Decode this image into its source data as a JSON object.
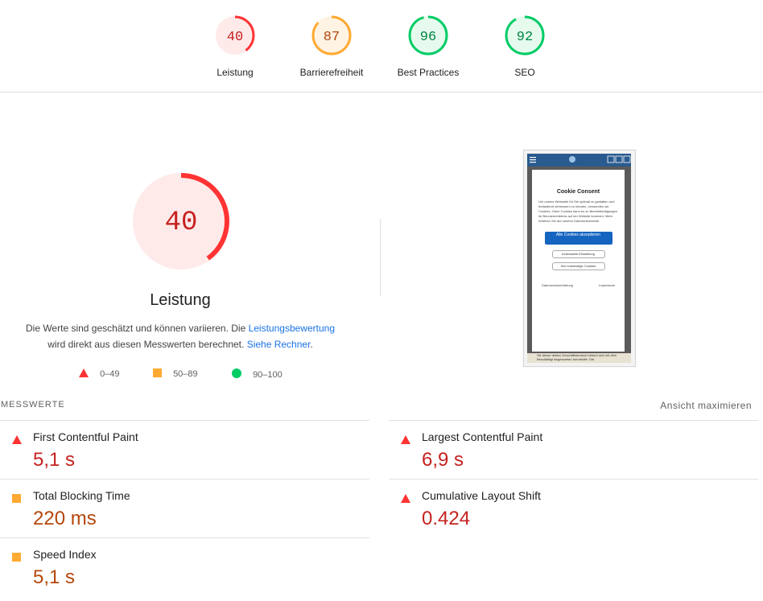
{
  "colors": {
    "fail": "#f33",
    "average": "#fa3",
    "pass": "#0c6",
    "fail_text": "#c5221f",
    "average_text": "#b5470b",
    "link": "#1a73e8"
  },
  "gauges": [
    {
      "score": "40",
      "label": "Leistung",
      "status": "fail"
    },
    {
      "score": "87",
      "label": "Barrierefreiheit",
      "status": "average"
    },
    {
      "score": "96",
      "label": "Best Practices",
      "status": "pass"
    },
    {
      "score": "92",
      "label": "SEO",
      "status": "pass"
    }
  ],
  "performance": {
    "score": "40",
    "title": "Leistung",
    "desc_part1": "Die Werte sind geschätzt und können variieren. Die ",
    "desc_link1": "Leistungsbewertung",
    "desc_part2": "wird direkt aus diesen Messwerten berechnet. ",
    "desc_link2": "Siehe Rechner",
    "desc_part3": "."
  },
  "legend": [
    {
      "icon": "triangle-icon",
      "range": "0–49"
    },
    {
      "icon": "square-icon",
      "range": "50–89"
    },
    {
      "icon": "circle-icon",
      "range": "90–100"
    }
  ],
  "screenshot": {
    "dialog_title": "Cookie Consent",
    "dialog_text": "Um unsere Webseite für Sie optimal zu gestalten und fortlaufend verbessern zu können, verwenden wir Cookies. Ohne Cookies kann es zu Beeinträchtigungen im Benutzererlebnis auf der Website kommen. Mehr erfahren Sie auf unserer Datenschutzseite.",
    "accept_all": "Alle Cookies akzeptieren",
    "individual": "Individuelle Einstellung",
    "necessary_only": "Nur notwendige Cookies",
    "privacy": "Datenschutzerklärung",
    "imprint": "Impressum",
    "footer_text": "Sie dieser dritten Geschäftsbereich befund sich mit dem Beschäftigt insgesamten formdröffe. Die"
  },
  "metrics_header": "MESSWERTE",
  "maximize": "Ansicht maximieren",
  "metrics": [
    {
      "name": "First Contentful Paint",
      "value": "5,1 s",
      "status": "fail"
    },
    {
      "name": "Largest Contentful Paint",
      "value": "6,9 s",
      "status": "fail"
    },
    {
      "name": "Total Blocking Time",
      "value": "220 ms",
      "status": "average"
    },
    {
      "name": "Cumulative Layout Shift",
      "value": "0.424",
      "status": "fail"
    },
    {
      "name": "Speed Index",
      "value": "5,1 s",
      "status": "average"
    }
  ]
}
